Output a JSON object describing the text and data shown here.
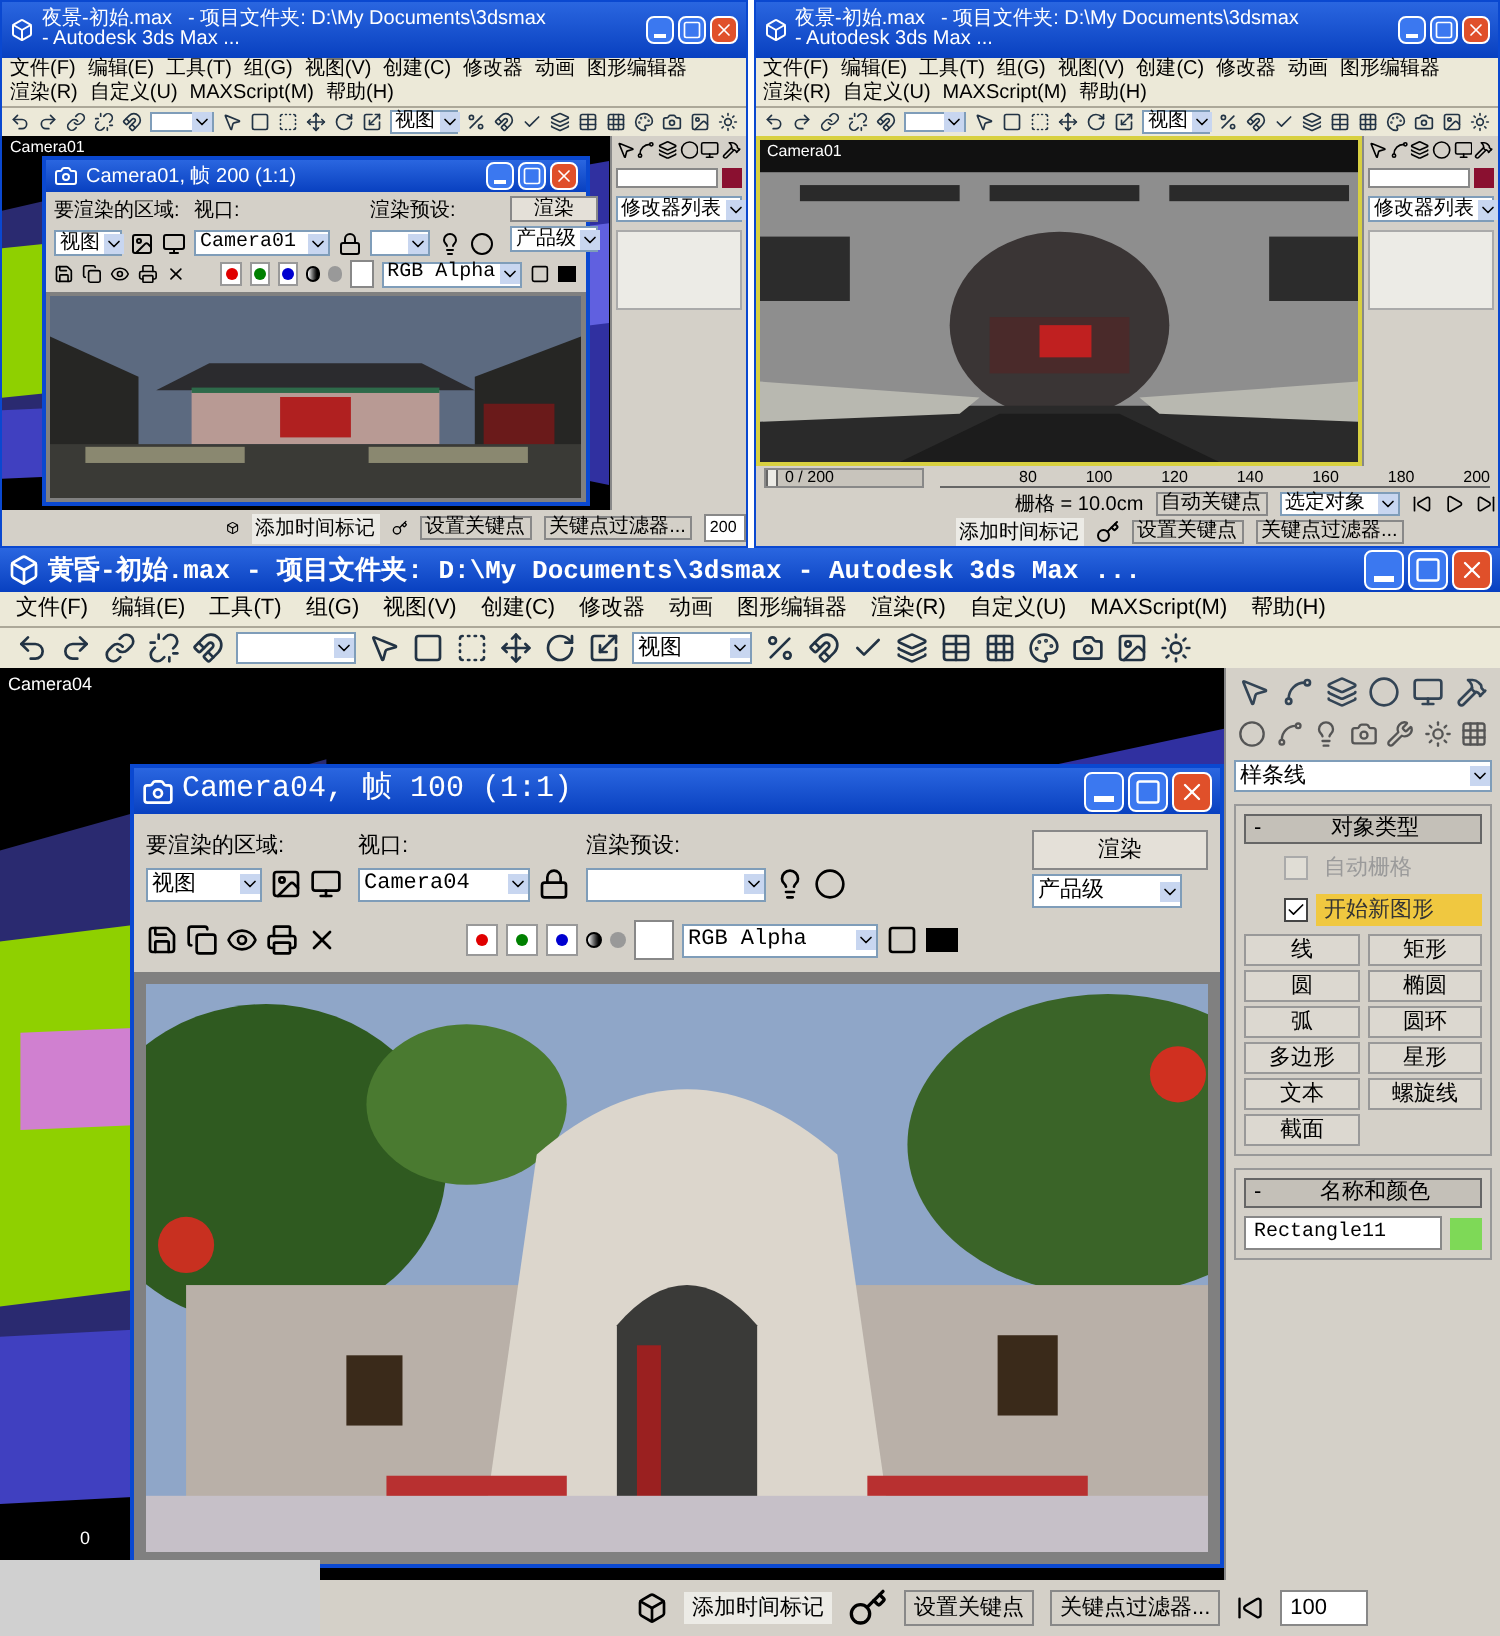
{
  "top_windows": [
    {
      "kind": "render_view",
      "title": "夜景-初始.max",
      "project": "- 项目文件夹: D:\\My Documents\\3dsmax",
      "app": "- Autodesk 3ds Max ...",
      "menu": [
        "文件(F)",
        "编辑(E)",
        "工具(T)",
        "组(G)",
        "视图(V)",
        "创建(C)",
        "修改器",
        "动画",
        "图形编辑器",
        "渲染(R)",
        "自定义(U)",
        "MAXScript(M)",
        "帮助(H)"
      ],
      "view_dropdown": "视图",
      "viewport_label": "Camera01",
      "modifier_list": "修改器列表",
      "render_window": {
        "title": "Camera01, 帧 200 (1:1)",
        "area_label": "要渲染的区域:",
        "area_value": "视图",
        "viewport_label": "视口:",
        "viewport_value": "Camera01",
        "preset_label": "渲染预设:",
        "render_button": "渲染",
        "mode_value": "产品级",
        "channel_value": "RGB Alpha"
      },
      "status": [
        "添加时间标记",
        "设置关键点",
        "关键点过滤器...",
        "200"
      ]
    },
    {
      "kind": "timeline_view",
      "title": "夜景-初始.max",
      "project": "- 项目文件夹: D:\\My Documents\\3dsmax",
      "app": "- Autodesk 3ds Max ...",
      "menu": [
        "文件(F)",
        "编辑(E)",
        "工具(T)",
        "组(G)",
        "视图(V)",
        "创建(C)",
        "修改器",
        "动画",
        "图形编辑器",
        "渲染(R)",
        "自定义(U)",
        "MAXScript(M)",
        "帮助(H)"
      ],
      "view_dropdown": "视图",
      "viewport_label": "Camera01",
      "modifier_list": "修改器列表",
      "slider": {
        "text": "0 / 200",
        "level": 0
      },
      "ticks": [
        "80",
        "100",
        "120",
        "140",
        "160",
        "180",
        "200"
      ],
      "status": [
        "栅格 = 10.0cm",
        "自动关键点",
        "选定对象",
        "添加时间标记",
        "设置关键点",
        "关键点过滤器..."
      ]
    }
  ],
  "main_window": {
    "title": "黄昏-初始.max",
    "project": "- 项目文件夹: D:\\My Documents\\3dsmax",
    "app": "- Autodesk 3ds Max ...",
    "menu": [
      "文件(F)",
      "编辑(E)",
      "工具(T)",
      "组(G)",
      "视图(V)",
      "创建(C)",
      "修改器",
      "动画",
      "图形编辑器",
      "渲染(R)",
      "自定义(U)",
      "MAXScript(M)",
      "帮助(H)"
    ],
    "view_dropdown": "视图",
    "viewport_label": "Camera04",
    "render_window": {
      "title": "Camera04, 帧 100 (1:1)",
      "area_label": "要渲染的区域:",
      "area_value": "视图",
      "viewport_label": "视口:",
      "viewport_value": "Camera04",
      "preset_label": "渲染预设:",
      "render_button": "渲染",
      "mode_value": "产品级",
      "channel_value": "RGB Alpha"
    },
    "command_panel": {
      "dropdown": "样条线",
      "object_type": {
        "toggle": "-",
        "title": "对象类型",
        "checkboxes": [
          {
            "label": "自动栅格",
            "checked": false,
            "disabled": true
          },
          {
            "label": "开始新图形",
            "checked": true,
            "disabled": false
          }
        ],
        "buttons": [
          "线",
          "矩形",
          "圆",
          "椭圆",
          "弧",
          "圆环",
          "多边形",
          "星形",
          "文本",
          "螺旋线",
          "截面"
        ]
      },
      "name_color": {
        "toggle": "-",
        "title": "名称和颜色",
        "name": "Rectangle11",
        "color": "#7ed957"
      }
    },
    "ruler": "0",
    "status": [
      "添加时间标记",
      "设置关键点",
      "关键点过滤器...",
      "100"
    ]
  }
}
